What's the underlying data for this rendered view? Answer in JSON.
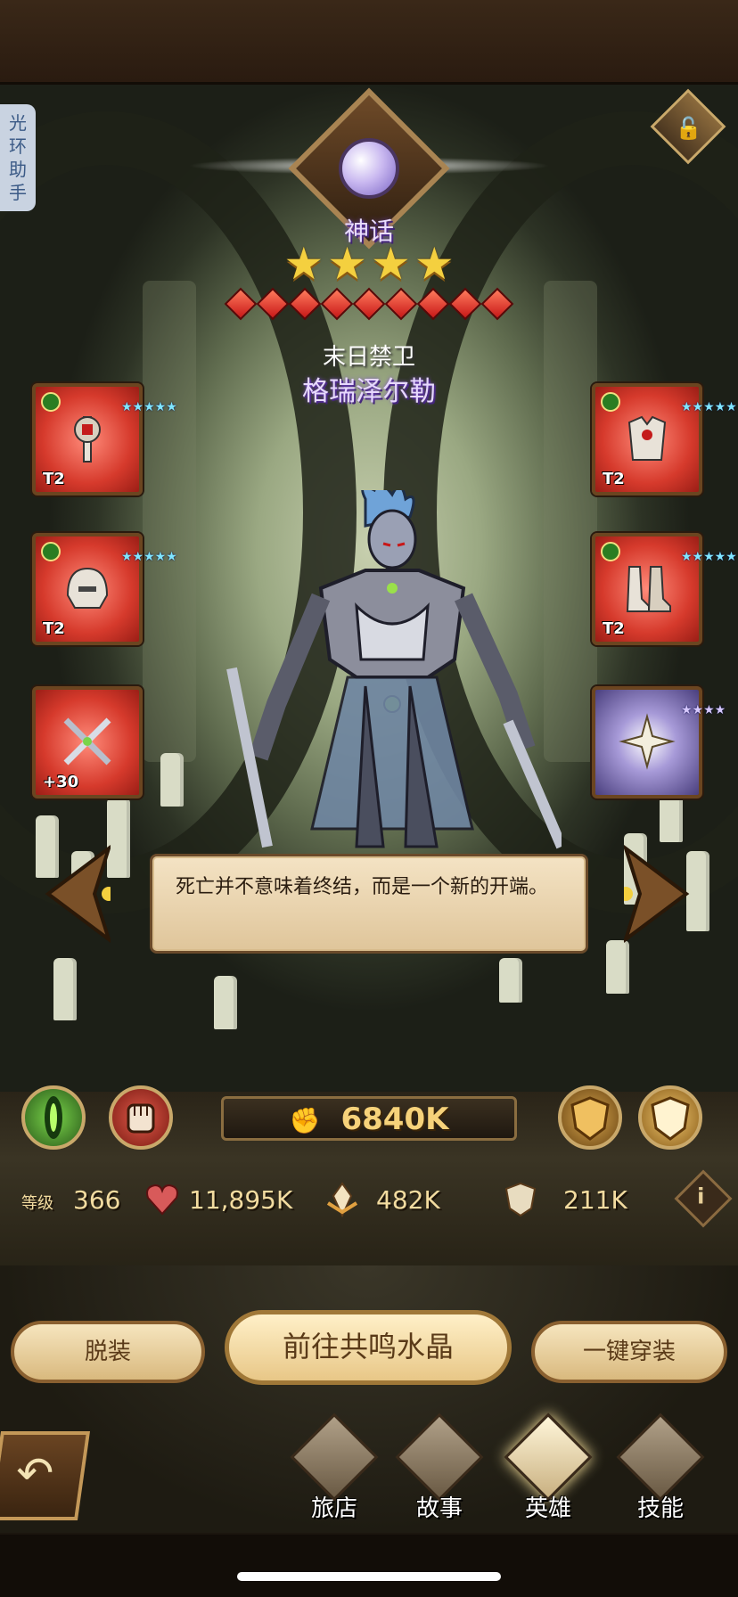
{
  "aura_helper": {
    "label": "光环助手"
  },
  "hero": {
    "rarity": "神话",
    "stars": 4,
    "ascension_gems": 9,
    "title": "末日禁卫",
    "name": "格瑞泽尔勒",
    "quote": "死亡并不意味着终结，而是一个新的开端。"
  },
  "equipment": {
    "left": [
      {
        "name": "weapon",
        "tier": "T2",
        "stars": 5
      },
      {
        "name": "helmet",
        "tier": "T2",
        "stars": 5
      },
      {
        "name": "signature-item",
        "tier": "+30",
        "stars": 0
      }
    ],
    "right": [
      {
        "name": "armor",
        "tier": "T2",
        "stars": 5
      },
      {
        "name": "boots",
        "tier": "T2",
        "stars": 5
      },
      {
        "name": "furniture",
        "tier": "",
        "stars": 4
      }
    ]
  },
  "stats": {
    "power": "6840K",
    "level_label": "等级",
    "level": "366",
    "hp": "11,895K",
    "attack": "482K",
    "defense": "211K"
  },
  "buttons": {
    "unequip": "脱装",
    "resonance": "前往共鸣水晶",
    "equip_all": "一键穿装"
  },
  "nav": [
    {
      "label": "旅店",
      "icon": "tavern-icon",
      "active": false
    },
    {
      "label": "故事",
      "icon": "story-book-icon",
      "active": false
    },
    {
      "label": "英雄",
      "icon": "hero-helmet-icon",
      "active": true
    },
    {
      "label": "技能",
      "icon": "skill-scroll-icon",
      "active": false
    }
  ],
  "colors": {
    "gold": "#f6d27a",
    "rarity_purple": "#e9dcff",
    "slot_red": "#d63a2c",
    "slot_purple": "#a79ad8",
    "accent_cyan": "#7fe6ff"
  }
}
